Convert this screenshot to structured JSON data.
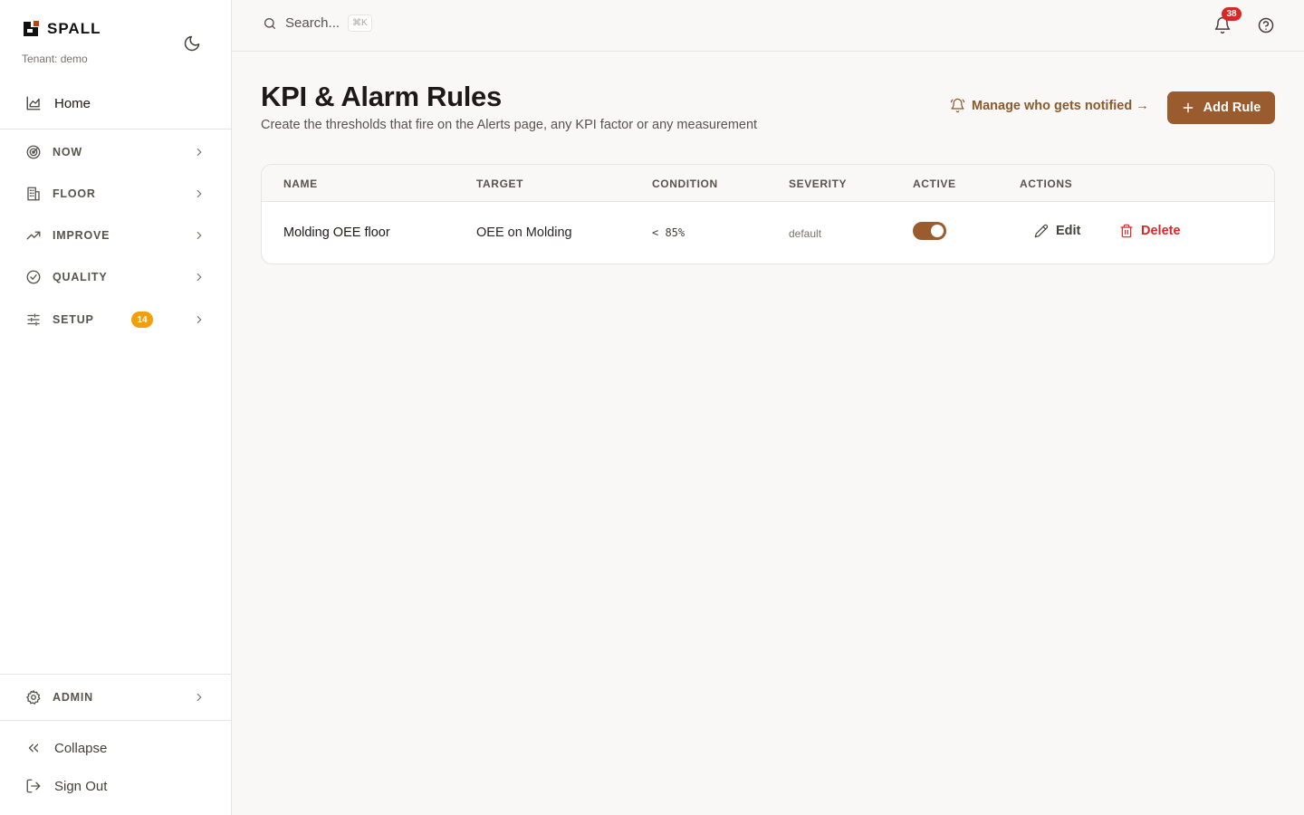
{
  "brand": {
    "name": "SPALL",
    "tenant": "Tenant: demo"
  },
  "sidebar": {
    "home": {
      "label": "Home",
      "icon": "chart-area-icon"
    },
    "sections": [
      {
        "label": "NOW",
        "icon": "radar-icon"
      },
      {
        "label": "FLOOR",
        "icon": "building-icon"
      },
      {
        "label": "IMPROVE",
        "icon": "trending-up-icon"
      },
      {
        "label": "QUALITY",
        "icon": "check-circle-icon"
      },
      {
        "label": "SETUP",
        "icon": "sliders-icon",
        "badge": "14"
      }
    ],
    "admin": {
      "label": "ADMIN",
      "icon": "gear-icon"
    },
    "collapse": {
      "label": "Collapse",
      "icon": "chevrons-left-icon"
    },
    "signout": {
      "label": "Sign Out",
      "icon": "logout-icon"
    }
  },
  "topbar": {
    "search_placeholder": "Search...",
    "search_shortcut": "⌘K",
    "notification_count": "38"
  },
  "page": {
    "title": "KPI & Alarm Rules",
    "subtitle": "Create the thresholds that fire on the Alerts page, any KPI factor or any measurement",
    "manage_link": "Manage who gets notified →",
    "add_button": "Add Rule"
  },
  "table": {
    "columns": [
      "NAME",
      "TARGET",
      "CONDITION",
      "SEVERITY",
      "ACTIVE",
      "ACTIONS"
    ],
    "rows": [
      {
        "name": "Molding OEE floor",
        "target": "OEE on Molding",
        "condition": "< 85%",
        "severity": "default",
        "active": true,
        "edit_label": "Edit",
        "delete_label": "Delete"
      }
    ]
  },
  "colors": {
    "accent": "#9a5b2e",
    "accent_text": "#8b5a2b",
    "danger": "#dc2626",
    "badge_warning": "#f59e0b",
    "background": "#f9f8f6"
  }
}
